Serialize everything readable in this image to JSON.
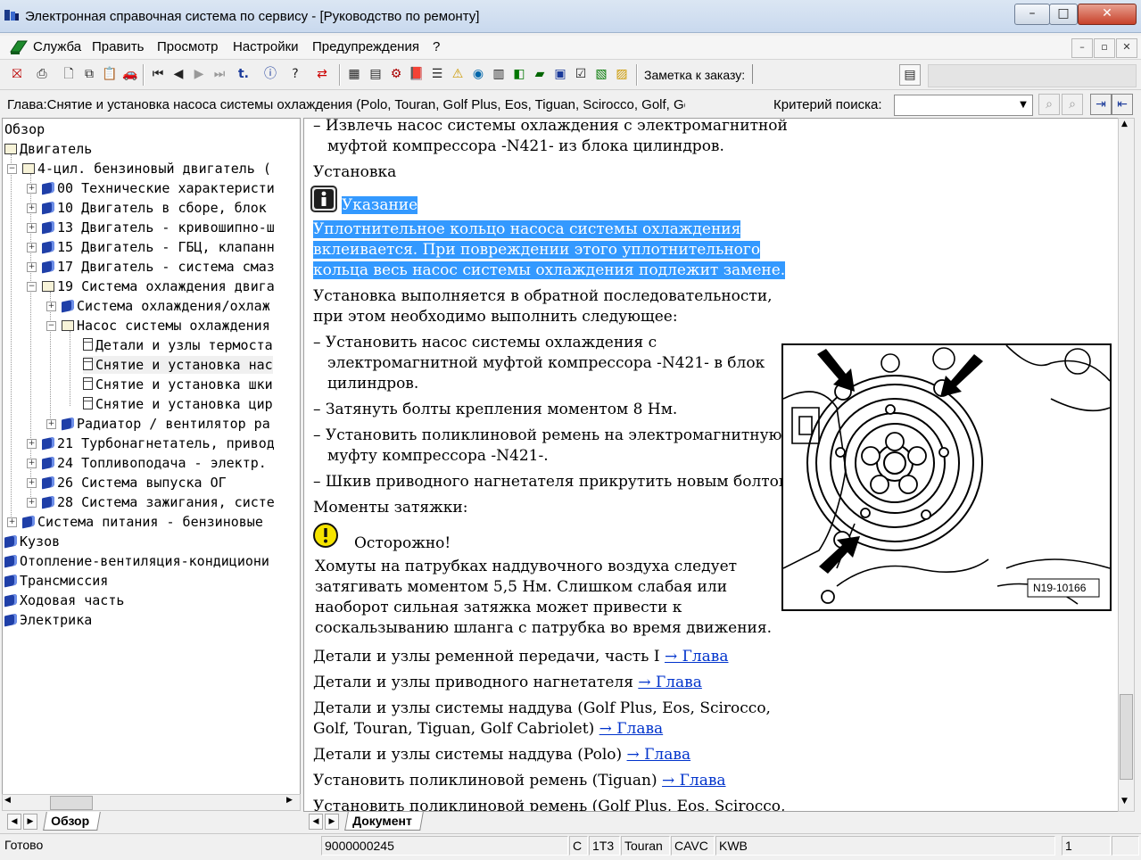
{
  "window": {
    "title": "Электронная справочная система по сервису - [Руководство по ремонту]",
    "min": "–",
    "max": "□",
    "close": "✕"
  },
  "menu": {
    "items": [
      "Служба",
      "Править",
      "Просмотр",
      "Настройки",
      "Предупреждения",
      "?"
    ]
  },
  "toolbar": {
    "order_label": "Заметка к заказу:"
  },
  "chapter": {
    "text": "Глава:Снятие и установка насоса системы охлаждения (Polo, Touran, Golf Plus, Eos, Tiguan, Scirocco, Golf, Golf",
    "criteria_label": "Критерий  поиска:"
  },
  "tree": {
    "items": [
      "Обзор",
      "Двигатель",
      "4-цил. бензиновый двигатель (",
      "00 Технические характеристи",
      "10 Двигатель в сборе, блок",
      "13 Двигатель - кривошипно-ш",
      "15 Двигатель - ГБЦ, клапанн",
      "17 Двигатель - система смаз",
      "19 Система охлаждения двига",
      "Система охлаждения/охлаж",
      "Насос системы охлаждения",
      "Детали и узлы термоста",
      "Снятие и установка нас",
      "Снятие и установка шки",
      "Снятие и установка цир",
      "Радиатор / вентилятор ра",
      "21 Турбонагнетатель, привод",
      "24 Топливоподача - электр.",
      "26 Система выпуска ОГ",
      "28 Система зажигания, систе",
      "Система питания - бензиновые",
      "Кузов",
      "Отопление-вентиляция-кондициони",
      "Трансмиссия",
      "Ходовая часть",
      "Электрика"
    ],
    "tab": "Обзор"
  },
  "content": {
    "l1": "– Извлечь насос системы охлаждения с электромагнитной",
    "l2": "муфтой компрессора -N421- из блока цилиндров.",
    "install_heading": "Установка",
    "note_title": "Указание",
    "note1": "Уплотнительное кольцо насоса системы охлаждения",
    "note2": "вклеивается. При повреждении этого уплотнительного",
    "note3": "кольца весь насос системы охлаждения подлежит замене.",
    "p1": "Установка выполняется в обратной последовательности,",
    "p2": "при этом необходимо выполнить следующее:",
    "s1a": "– Установить насос системы охлаждения с",
    "s1b": "электромагнитной муфтой компрессора -N421- в блок",
    "s1c": "цилиндров.",
    "s2": "– Затянуть болты крепления моментом 8 Нм.",
    "s3a": "– Установить поликлиновой ремень на электромагнитную",
    "s3b": "муфту компрессора -N421-.",
    "s4": "– Шкив приводного нагнетателя прикрутить новым болтом.",
    "torque_heading": "Моменты затяжки:",
    "caution_title": "Осторожно!",
    "c1": "Хомуты на патрубках наддувочного воздуха следует",
    "c2": "затягивать моментом 5,5 Нм. Слишком слабая или",
    "c3": "наоборот сильная затяжка может привести к",
    "c4": "соскальзыванию шланга с патрубка во время движения.",
    "r1": "Детали и узлы ременной передачи, часть I ",
    "r2": "Детали и узлы приводного нагнетателя ",
    "r3a": "Детали и узлы системы наддува (Golf Plus, Eos, Scirocco,",
    "r3b": "Golf, Touran, Tiguan, Golf Cabriolet) ",
    "r4": "Детали и узлы системы наддува (Polo) ",
    "r5": "Установить поликлиновой ремень (Tiguan) ",
    "r6": "Установить поликлиновой ремень (Golf Plus, Eos, Scirocco,",
    "link": "→ Глава",
    "figure_label": "N19-10166",
    "tab": "Документ"
  },
  "status": {
    "ready": "Готово",
    "code": "9000000245",
    "c": "С",
    "model_code": "1T3",
    "model": "Touran",
    "engine": "CAVC",
    "gear": "KWB",
    "page": "1"
  }
}
